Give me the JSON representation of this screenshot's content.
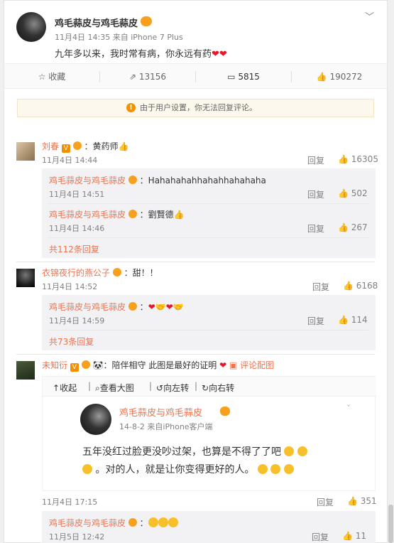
{
  "post": {
    "author": "鸡毛蒜皮与鸡毛蒜皮",
    "time": "11月4日 14:35",
    "source": "来自 iPhone 7 Plus",
    "text": "九年多以来，我时常有病，你永远有药"
  },
  "toolbar": {
    "fav_label": "收藏",
    "repost_count": "13156",
    "comment_count": "5815",
    "like_count": "190272"
  },
  "notice": "由于用户设置，你无法回复评论。",
  "comments": [
    {
      "user": "刘春",
      "text": "：黄药师",
      "time": "11月4日 14:44",
      "reply_label": "回复",
      "likes": "16305",
      "replies": [
        {
          "user": "鸡毛蒜皮与鸡毛蒜皮",
          "text": "：Hahahahahhahahhahahaha",
          "time": "11月4日 14:51",
          "reply_label": "回复",
          "likes": "502"
        },
        {
          "user": "鸡毛蒜皮与鸡毛蒜皮",
          "text": "：劉賢德",
          "time": "11月4日 14:46",
          "reply_label": "回复",
          "likes": "267"
        }
      ],
      "more": "共112条回复"
    },
    {
      "user": "衣锦夜行的燕公子",
      "text": "：甜！！",
      "time": "11月4日 14:52",
      "reply_label": "回复",
      "likes": "6168",
      "replies": [
        {
          "user": "鸡毛蒜皮与鸡毛蒜皮",
          "text": "：",
          "time": "11月4日 14:59",
          "reply_label": "回复",
          "likes": "114"
        }
      ],
      "more": "共73条回复"
    },
    {
      "user": "未知衍",
      "text": "：陪伴相守 此图是最好的证明",
      "image_link": "评论配图",
      "time": "11月4日 17:15",
      "reply_label": "回复",
      "likes": "351",
      "replies": [
        {
          "user": "鸡毛蒜皮与鸡毛蒜皮",
          "text": "：",
          "time": "11月5日 12:42",
          "reply_label": "回复",
          "likes": "11"
        }
      ]
    }
  ],
  "image_viewer": {
    "collapse": "收起",
    "view_large": "查看大图",
    "rotate_left": "向左转",
    "rotate_right": "向右转",
    "embed_author": "鸡毛蒜皮与鸡毛蒜皮",
    "embed_meta": "14-8-2  来自iPhone客户端",
    "embed_line1": "五年没红过脸更没吵过架，也算是不得了了吧",
    "embed_line2": "。对的人，就是让你变得更好的人。"
  },
  "colors": {
    "link": "#eb7350",
    "accent_orange": "#f29100",
    "heart": "#e6162d",
    "reply_bg": "#f2f2f5"
  }
}
